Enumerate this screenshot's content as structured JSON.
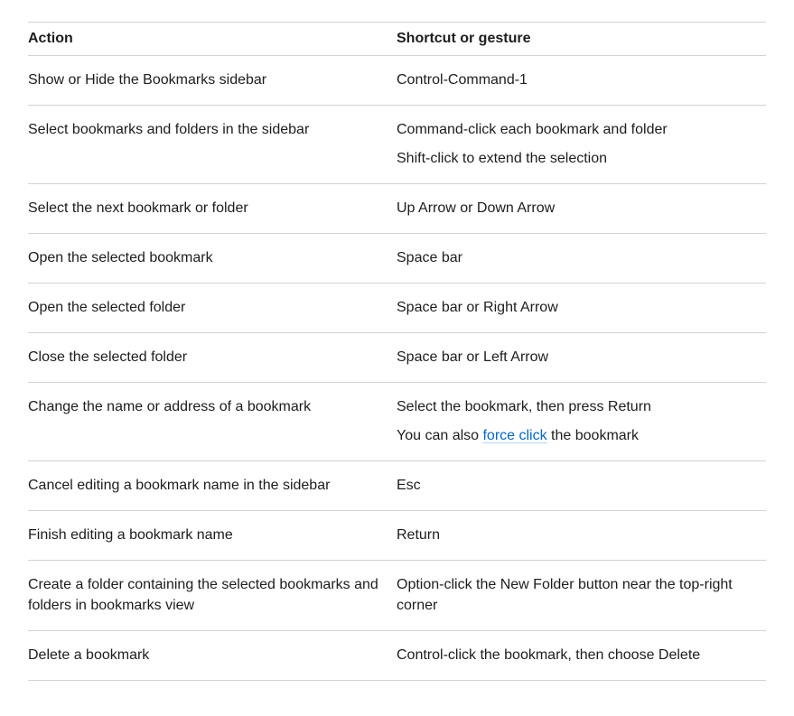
{
  "table": {
    "headers": {
      "action": "Action",
      "shortcut": "Shortcut or gesture"
    },
    "rows": [
      {
        "action": "Show or Hide the Bookmarks sidebar",
        "shortcut": [
          "Control-Command-1"
        ]
      },
      {
        "action": "Select bookmarks and folders in the sidebar",
        "shortcut": [
          "Command-click each bookmark and folder",
          "Shift-click to extend the selection"
        ]
      },
      {
        "action": "Select the next bookmark or folder",
        "shortcut": [
          "Up Arrow or Down Arrow"
        ]
      },
      {
        "action": "Open the selected bookmark",
        "shortcut": [
          "Space bar"
        ]
      },
      {
        "action": "Open the selected folder",
        "shortcut": [
          "Space bar or Right Arrow"
        ]
      },
      {
        "action": "Close the selected folder",
        "shortcut": [
          "Space bar or Left Arrow"
        ]
      },
      {
        "action": "Change the name or address of a bookmark",
        "shortcut": [
          "Select the bookmark, then press Return"
        ],
        "extra": {
          "before": "You can also ",
          "link": "force click",
          "after": " the bookmark"
        }
      },
      {
        "action": "Cancel editing a bookmark name in the sidebar",
        "shortcut": [
          "Esc"
        ]
      },
      {
        "action": "Finish editing a bookmark name",
        "shortcut": [
          "Return"
        ]
      },
      {
        "action": "Create a folder containing the selected bookmarks and folders in bookmarks view",
        "shortcut": [
          "Option-click the New Folder button near the top-right corner"
        ]
      },
      {
        "action": "Delete a bookmark",
        "shortcut": [
          "Control-click the bookmark, then choose Delete"
        ]
      }
    ]
  },
  "colors": {
    "text": "#1d1d1f",
    "link": "#0066cc",
    "divider": "#d2d2d7"
  }
}
